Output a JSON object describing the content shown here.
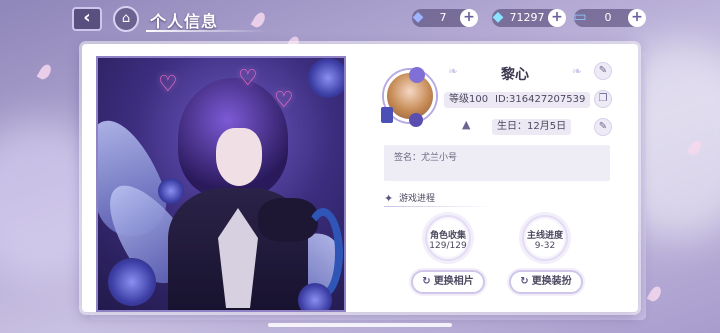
{
  "header": {
    "title": "个人信息"
  },
  "resources": [
    {
      "name": "diamond-blue",
      "value": "7",
      "icon": "diamond-icon",
      "color": "#9fb3ff"
    },
    {
      "name": "diamond-pink",
      "value": "71297",
      "icon": "gem-icon",
      "color": "#8be3ff"
    },
    {
      "name": "ticket",
      "value": "0",
      "icon": "ticket-icon",
      "color": "#8fd0ff"
    }
  ],
  "profile": {
    "name": "黎心",
    "level": "等级100",
    "id": "ID:316427207539",
    "birthday": "生日：12月5日",
    "signature": "签名：尤兰小号"
  },
  "progress": {
    "section_label": "游戏进程",
    "stats": [
      {
        "title": "角色收集",
        "value": "129/129"
      },
      {
        "title": "主线进度",
        "value": "9-32"
      }
    ]
  },
  "actions": {
    "change_photo": "更换相片",
    "change_outfit": "更换装扮"
  },
  "icons": {
    "back": "back-arrow-icon",
    "home": "home-icon",
    "edit": "pencil-icon",
    "copy": "copy-icon",
    "cake": "cake-icon",
    "refresh": "refresh-icon"
  },
  "colors": {
    "accent": "#8f82c6",
    "panel": "#ffffff",
    "text": "#4d4860"
  }
}
